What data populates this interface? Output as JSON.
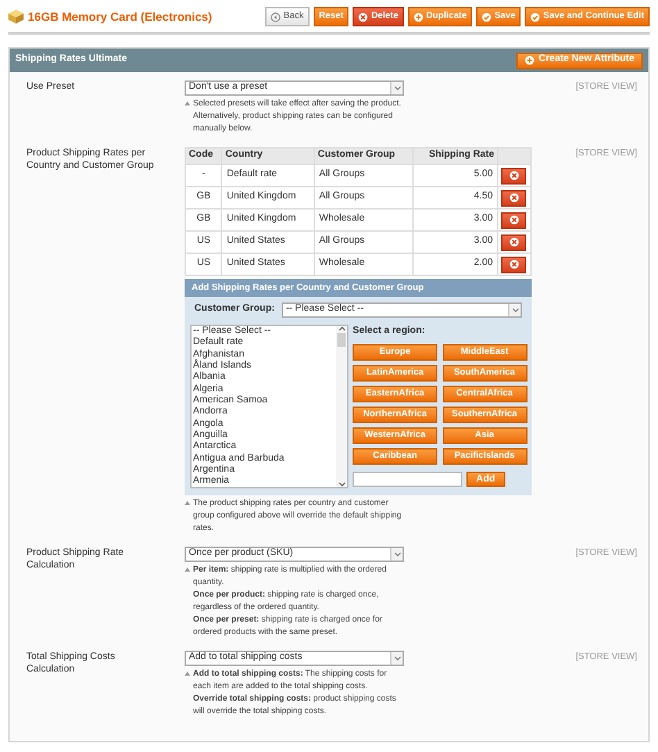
{
  "header": {
    "title": "16GB Memory Card (Electronics)",
    "buttons": [
      {
        "label": "Back",
        "kind": "back"
      },
      {
        "label": "Reset",
        "kind": "reset"
      },
      {
        "label": "Delete",
        "kind": "delete"
      },
      {
        "label": "Duplicate",
        "kind": "duplicate"
      },
      {
        "label": "Save",
        "kind": "save"
      },
      {
        "label": "Save and Continue Edit",
        "kind": "save"
      }
    ]
  },
  "panel": {
    "title": "Shipping Rates Ultimate",
    "button": {
      "label": "Create New Attribute"
    },
    "rows": [
      {
        "kind": "select",
        "label": "Use Preset",
        "value": "Don't use a preset",
        "scope": "[STORE VIEW]",
        "notes": [
          "Selected presets will take effect after saving the product. Alternatively, product shipping rates can be configured manually below."
        ]
      },
      {
        "kind": "rates",
        "label": "Product Shipping Rates per Country and Customer Group",
        "scope": "[STORE VIEW]",
        "table": {
          "columns": [
            "Code",
            "Country",
            "Customer Group",
            "Shipping Rate"
          ],
          "rows": [
            [
              "-",
              "Default rate",
              "All Groups",
              "5.00"
            ],
            [
              "GB",
              "United Kingdom",
              "All Groups",
              "4.50"
            ],
            [
              "GB",
              "United Kingdom",
              "Wholesale",
              "3.00"
            ],
            [
              "US",
              "United States",
              "All Groups",
              "3.00"
            ],
            [
              "US",
              "United States",
              "Wholesale",
              "2.00"
            ]
          ]
        },
        "add_box": {
          "title": "Add Shipping Rates per Country and Customer Group",
          "group_label": "Customer Group:",
          "group_value": "-- Please Select --",
          "countries": [
            "-- Please Select --",
            "Default rate",
            "Afghanistan",
            "Åland Islands",
            "Albania",
            "Algeria",
            "American Samoa",
            "Andorra",
            "Angola",
            "Anguilla",
            "Antarctica",
            "Antigua and Barbuda",
            "Argentina",
            "Armenia"
          ],
          "region_label": "Select a region:",
          "regions": [
            "Europe",
            "MiddleEast",
            "LatinAmerica",
            "SouthAmerica",
            "EasternAfrica",
            "CentralAfrica",
            "NorthernAfrica",
            "SouthernAfrica",
            "WesternAfrica",
            "Asia",
            "Caribbean",
            "PacificIslands"
          ],
          "add_button": "Add"
        },
        "notes": [
          "The product shipping rates per country and customer group configured above will override the default shipping rates."
        ]
      },
      {
        "kind": "select",
        "label": "Product Shipping Rate Calculation",
        "value": "Once per product (SKU)",
        "scope": "[STORE VIEW]",
        "notes": [
          "**Per item:** shipping rate is multiplied with the ordered quantity.",
          "**Once per product:** shipping rate is charged once, regardless of the ordered quantity.",
          "**Once per preset:** shipping rate is charged once for ordered products with the same preset."
        ]
      },
      {
        "kind": "select",
        "label": "Total Shipping Costs Calculation",
        "value": "Add to total shipping costs",
        "scope": "[STORE VIEW]",
        "notes": [
          "**Add to total shipping costs:** The shipping costs for each item are added to the total shipping costs.",
          "**Override total shipping costs:** product shipping costs will override the total shipping costs."
        ]
      }
    ]
  }
}
